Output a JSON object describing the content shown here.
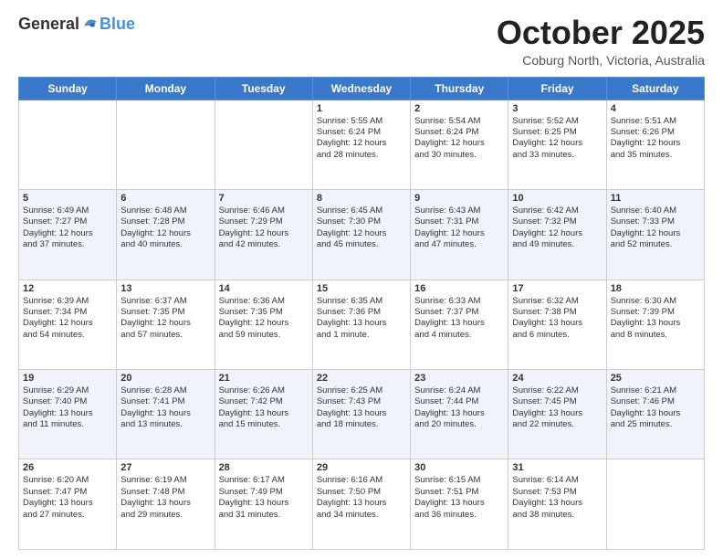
{
  "logo": {
    "general": "General",
    "blue": "Blue"
  },
  "header": {
    "month": "October 2025",
    "location": "Coburg North, Victoria, Australia"
  },
  "days_of_week": [
    "Sunday",
    "Monday",
    "Tuesday",
    "Wednesday",
    "Thursday",
    "Friday",
    "Saturday"
  ],
  "weeks": [
    [
      {
        "day": "",
        "info": ""
      },
      {
        "day": "",
        "info": ""
      },
      {
        "day": "",
        "info": ""
      },
      {
        "day": "1",
        "info": "Sunrise: 5:55 AM\nSunset: 6:24 PM\nDaylight: 12 hours\nand 28 minutes."
      },
      {
        "day": "2",
        "info": "Sunrise: 5:54 AM\nSunset: 6:24 PM\nDaylight: 12 hours\nand 30 minutes."
      },
      {
        "day": "3",
        "info": "Sunrise: 5:52 AM\nSunset: 6:25 PM\nDaylight: 12 hours\nand 33 minutes."
      },
      {
        "day": "4",
        "info": "Sunrise: 5:51 AM\nSunset: 6:26 PM\nDaylight: 12 hours\nand 35 minutes."
      }
    ],
    [
      {
        "day": "5",
        "info": "Sunrise: 6:49 AM\nSunset: 7:27 PM\nDaylight: 12 hours\nand 37 minutes."
      },
      {
        "day": "6",
        "info": "Sunrise: 6:48 AM\nSunset: 7:28 PM\nDaylight: 12 hours\nand 40 minutes."
      },
      {
        "day": "7",
        "info": "Sunrise: 6:46 AM\nSunset: 7:29 PM\nDaylight: 12 hours\nand 42 minutes."
      },
      {
        "day": "8",
        "info": "Sunrise: 6:45 AM\nSunset: 7:30 PM\nDaylight: 12 hours\nand 45 minutes."
      },
      {
        "day": "9",
        "info": "Sunrise: 6:43 AM\nSunset: 7:31 PM\nDaylight: 12 hours\nand 47 minutes."
      },
      {
        "day": "10",
        "info": "Sunrise: 6:42 AM\nSunset: 7:32 PM\nDaylight: 12 hours\nand 49 minutes."
      },
      {
        "day": "11",
        "info": "Sunrise: 6:40 AM\nSunset: 7:33 PM\nDaylight: 12 hours\nand 52 minutes."
      }
    ],
    [
      {
        "day": "12",
        "info": "Sunrise: 6:39 AM\nSunset: 7:34 PM\nDaylight: 12 hours\nand 54 minutes."
      },
      {
        "day": "13",
        "info": "Sunrise: 6:37 AM\nSunset: 7:35 PM\nDaylight: 12 hours\nand 57 minutes."
      },
      {
        "day": "14",
        "info": "Sunrise: 6:36 AM\nSunset: 7:35 PM\nDaylight: 12 hours\nand 59 minutes."
      },
      {
        "day": "15",
        "info": "Sunrise: 6:35 AM\nSunset: 7:36 PM\nDaylight: 13 hours\nand 1 minute."
      },
      {
        "day": "16",
        "info": "Sunrise: 6:33 AM\nSunset: 7:37 PM\nDaylight: 13 hours\nand 4 minutes."
      },
      {
        "day": "17",
        "info": "Sunrise: 6:32 AM\nSunset: 7:38 PM\nDaylight: 13 hours\nand 6 minutes."
      },
      {
        "day": "18",
        "info": "Sunrise: 6:30 AM\nSunset: 7:39 PM\nDaylight: 13 hours\nand 8 minutes."
      }
    ],
    [
      {
        "day": "19",
        "info": "Sunrise: 6:29 AM\nSunset: 7:40 PM\nDaylight: 13 hours\nand 11 minutes."
      },
      {
        "day": "20",
        "info": "Sunrise: 6:28 AM\nSunset: 7:41 PM\nDaylight: 13 hours\nand 13 minutes."
      },
      {
        "day": "21",
        "info": "Sunrise: 6:26 AM\nSunset: 7:42 PM\nDaylight: 13 hours\nand 15 minutes."
      },
      {
        "day": "22",
        "info": "Sunrise: 6:25 AM\nSunset: 7:43 PM\nDaylight: 13 hours\nand 18 minutes."
      },
      {
        "day": "23",
        "info": "Sunrise: 6:24 AM\nSunset: 7:44 PM\nDaylight: 13 hours\nand 20 minutes."
      },
      {
        "day": "24",
        "info": "Sunrise: 6:22 AM\nSunset: 7:45 PM\nDaylight: 13 hours\nand 22 minutes."
      },
      {
        "day": "25",
        "info": "Sunrise: 6:21 AM\nSunset: 7:46 PM\nDaylight: 13 hours\nand 25 minutes."
      }
    ],
    [
      {
        "day": "26",
        "info": "Sunrise: 6:20 AM\nSunset: 7:47 PM\nDaylight: 13 hours\nand 27 minutes."
      },
      {
        "day": "27",
        "info": "Sunrise: 6:19 AM\nSunset: 7:48 PM\nDaylight: 13 hours\nand 29 minutes."
      },
      {
        "day": "28",
        "info": "Sunrise: 6:17 AM\nSunset: 7:49 PM\nDaylight: 13 hours\nand 31 minutes."
      },
      {
        "day": "29",
        "info": "Sunrise: 6:16 AM\nSunset: 7:50 PM\nDaylight: 13 hours\nand 34 minutes."
      },
      {
        "day": "30",
        "info": "Sunrise: 6:15 AM\nSunset: 7:51 PM\nDaylight: 13 hours\nand 36 minutes."
      },
      {
        "day": "31",
        "info": "Sunrise: 6:14 AM\nSunset: 7:53 PM\nDaylight: 13 hours\nand 38 minutes."
      },
      {
        "day": "",
        "info": ""
      }
    ]
  ]
}
